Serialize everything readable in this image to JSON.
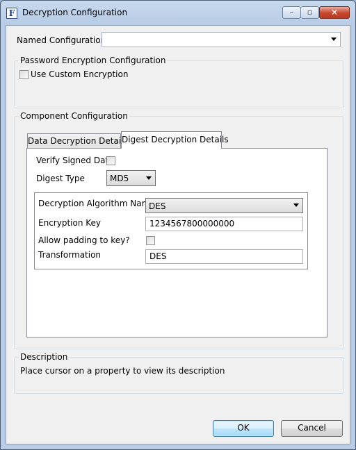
{
  "window": {
    "title": "Decryption Configuration",
    "app_icon_letter": "F",
    "controls": {
      "minimize": "–",
      "maximize": "▫",
      "close": "✕"
    }
  },
  "named_configuration": {
    "label": "Named Configuration",
    "value": ""
  },
  "password_encryption": {
    "title": "Password Encryption Configuration",
    "use_custom_label": "Use Custom Encryption",
    "use_custom_checked": false
  },
  "component_configuration": {
    "title": "Component Configuration",
    "tabs": [
      {
        "label": "Data Decryption Details",
        "active": false
      },
      {
        "label": "Digest Decryption Details",
        "active": true
      }
    ],
    "verify_signed_data": {
      "label": "Verify Signed Data",
      "checked": false
    },
    "digest_type": {
      "label": "Digest Type",
      "value": "MD5"
    },
    "inner": {
      "algorithm": {
        "label": "Decryption Algorithm Name",
        "value": "DES"
      },
      "encryption_key": {
        "label": "Encryption Key",
        "value": "1234567800000000"
      },
      "allow_padding": {
        "label": "Allow padding to key?",
        "checked": false
      },
      "transformation": {
        "label": "Transformation",
        "value": "DES"
      }
    }
  },
  "description": {
    "title": "Description",
    "text": "Place cursor on a property to view its description"
  },
  "buttons": {
    "ok": "OK",
    "cancel": "Cancel"
  }
}
